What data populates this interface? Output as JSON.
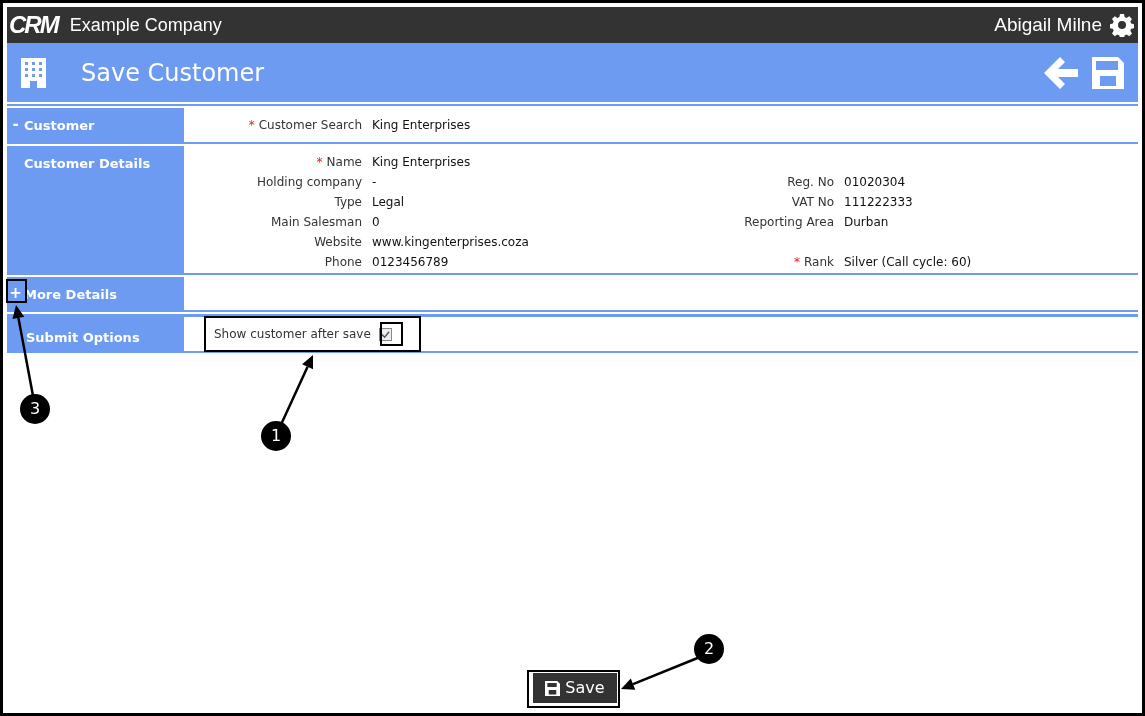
{
  "topbar": {
    "logo": "CRM",
    "company": "Example Company",
    "user": "Abigail Milne"
  },
  "header": {
    "title": "Save Customer"
  },
  "sections": [
    {
      "title": "Customer",
      "toggle": "-",
      "rows": [
        {
          "left": {
            "label": "Customer Search",
            "value": "King Enterprises",
            "required": true
          }
        }
      ]
    },
    {
      "title": "Customer Details",
      "rows": [
        {
          "left": {
            "label": "Name",
            "value": "King Enterprises",
            "required": true
          }
        },
        {
          "left": {
            "label": "Holding company",
            "value": "-",
            "required": false
          },
          "right": {
            "label": "Reg. No",
            "value": "01020304",
            "required": false
          }
        },
        {
          "left": {
            "label": "Type",
            "value": "Legal",
            "required": false
          },
          "right": {
            "label": "VAT No",
            "value": "111222333",
            "required": false
          }
        },
        {
          "left": {
            "label": "Main Salesman",
            "value": "0",
            "required": false
          },
          "right": {
            "label": "Reporting Area",
            "value": "Durban",
            "required": false
          }
        },
        {
          "left": {
            "label": "Website",
            "value": "www.kingenterprises.coza",
            "required": false
          }
        },
        {
          "left": {
            "label": "Phone",
            "value": "0123456789",
            "required": false
          },
          "right": {
            "label": "Rank",
            "value": "Silver (Call cycle: 60)",
            "required": true
          }
        }
      ]
    },
    {
      "title": "More Details",
      "toggle": "+"
    }
  ],
  "required_marker": "*",
  "submit_options": {
    "title": "Submit Options",
    "label": "Show customer after save",
    "checked": true
  },
  "save_button": {
    "label": "Save"
  },
  "callouts": [
    {
      "number": "1"
    },
    {
      "number": "2"
    },
    {
      "number": "3"
    }
  ]
}
